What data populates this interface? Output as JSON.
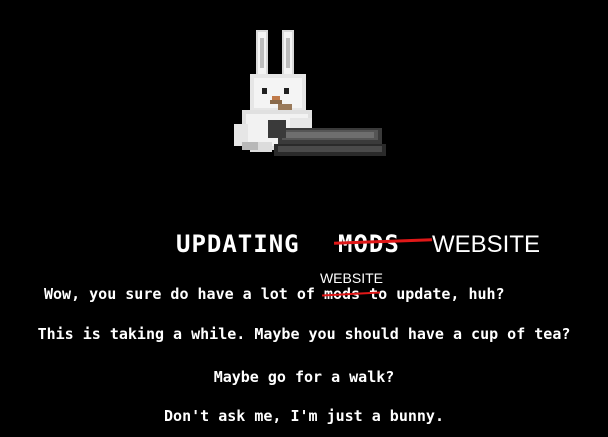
{
  "loading_screen": {
    "title": {
      "main": "UPDATING",
      "struck_word": "MODS",
      "replacement_word": "WEBSITE"
    },
    "lines": {
      "line1_before": "Wow, you sure do have a lot of",
      "line1_struck": "mods",
      "line1_replacement": "WEBSITE",
      "line1_after": "to update, huh?",
      "line2": "This is taking a while. Maybe you should have a cup of tea?",
      "line3": "Maybe go for a walk?",
      "line4": "Don't ask me, I'm just a bunny."
    },
    "icon": "bunny-with-laptop-icon",
    "colors": {
      "background": "#000000",
      "text": "#ffffff",
      "strike": "#e01818"
    }
  }
}
